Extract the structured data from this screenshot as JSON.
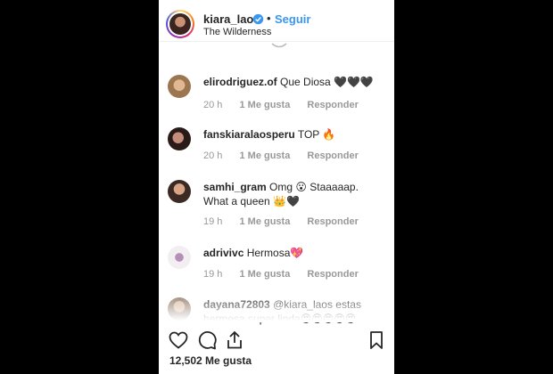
{
  "post": {
    "username": "kiara_laos",
    "separator": "•",
    "follow_label": "Seguir",
    "location": "The Wilderness"
  },
  "comments": [
    {
      "user": "elirodriguez.of",
      "text": "Que Diosa 🖤🖤🖤",
      "time": "20 h",
      "likes": "1 Me gusta",
      "reply": "Responder"
    },
    {
      "user": "fanskiaralaosperu",
      "text": "TOP 🔥",
      "time": "20 h",
      "likes": "1 Me gusta",
      "reply": "Responder"
    },
    {
      "user": "samhi_gram",
      "text": "Omg 😮 Staaaaap. What a queen 👑🖤",
      "time": "19 h",
      "likes": "1 Me gusta",
      "reply": "Responder"
    },
    {
      "user": "adrivivc",
      "text": "Hermosa💖",
      "time": "19 h",
      "likes": "1 Me gusta",
      "reply": "Responder"
    },
    {
      "user": "dayana72803",
      "text": "@kiara_laos estas hermosa super linda😍😍😍😍😍",
      "time": "",
      "likes": "",
      "reply": ""
    }
  ],
  "likes_total": "12,502 Me gusta",
  "icons": [
    "heart-icon",
    "comment-icon",
    "share-icon",
    "bookmark-icon",
    "verified-icon"
  ],
  "colors": {
    "link": "#3897f0",
    "text": "#262626",
    "meta": "#999999"
  }
}
